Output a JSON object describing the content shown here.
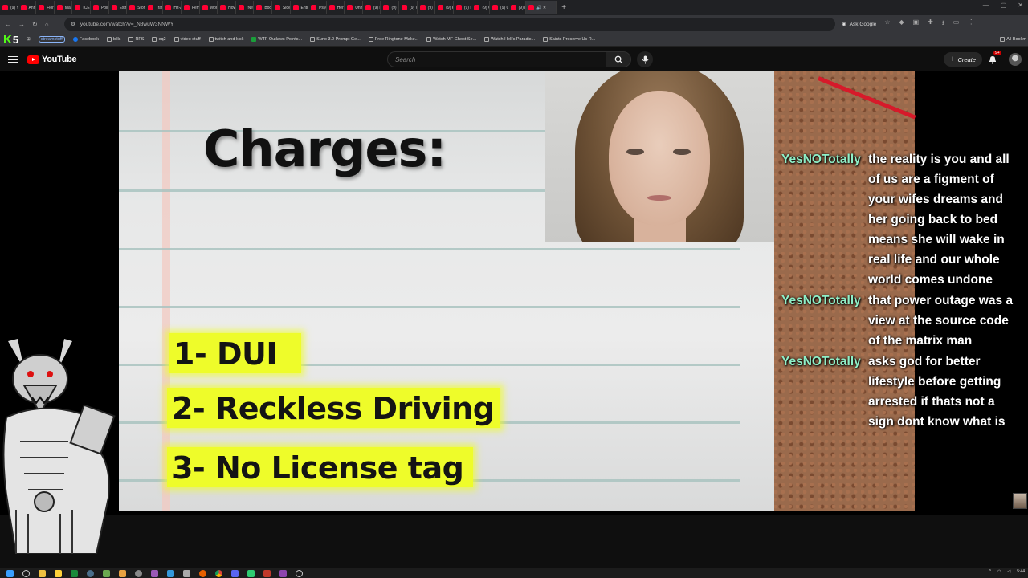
{
  "browser": {
    "tabs": [
      {
        "label": "(9) Yo"
      },
      {
        "label": "Anno"
      },
      {
        "label": "Florid"
      },
      {
        "label": "Male"
      },
      {
        "label": "ICE C"
      },
      {
        "label": "Polls"
      },
      {
        "label": "Extre"
      },
      {
        "label": "Store"
      },
      {
        "label": "Traffi"
      },
      {
        "label": "Hit-A"
      },
      {
        "label": "Fema"
      },
      {
        "label": "Wom"
      },
      {
        "label": "How"
      },
      {
        "label": "\"Nett"
      },
      {
        "label": "Body"
      },
      {
        "label": "Sidev"
      },
      {
        "label": "Entit"
      },
      {
        "label": "Psych"
      },
      {
        "label": "Her F"
      },
      {
        "label": "Unho"
      },
      {
        "label": "(9) H"
      },
      {
        "label": "(9) R"
      },
      {
        "label": "(9) W"
      },
      {
        "label": "(9) H"
      },
      {
        "label": "(9) K"
      },
      {
        "label": "(9) D"
      },
      {
        "label": "(9) Cr"
      },
      {
        "label": "(9) G"
      },
      {
        "label": "(9) E"
      }
    ],
    "url": "youtube.com/watch?v=_N8wuW3NNWY",
    "ask_google": "Ask Google",
    "bookmarks": [
      {
        "label": "streamstuff",
        "icon": "folder-icon"
      },
      {
        "label": "Facebook",
        "icon": "facebook-icon"
      },
      {
        "label": "bills",
        "icon": "folder-icon"
      },
      {
        "label": "RFS",
        "icon": "folder-icon"
      },
      {
        "label": "eq2",
        "icon": "folder-icon"
      },
      {
        "label": "video stuff",
        "icon": "folder-icon"
      },
      {
        "label": "twitch and kick",
        "icon": "folder-icon"
      },
      {
        "label": "WTF Outlaws Points...",
        "icon": "site-icon"
      },
      {
        "label": "Suno 3.0 Prompt Ge...",
        "icon": "site-icon"
      },
      {
        "label": "Free Ringtone Make...",
        "icon": "site-icon"
      },
      {
        "label": "Watch MF Ghost Se...",
        "icon": "site-icon"
      },
      {
        "label": "Watch Hell's Paradis...",
        "icon": "site-icon"
      },
      {
        "label": "Saints Preserve Us R...",
        "icon": "site-icon"
      }
    ],
    "all_bookmarks": "All Bookm"
  },
  "youtube": {
    "logo_text": "YouTube",
    "search_placeholder": "Search",
    "create_label": "Create",
    "notifications_badge": "9+"
  },
  "slide": {
    "title": "Charges:",
    "charges": [
      "1- DUI",
      "2- Reckless Driving",
      "3- No License tag"
    ]
  },
  "chat": [
    {
      "user": "YesNOTotally",
      "text": "the reality is you and all of us are a figment of your wifes dreams and her going back to bed means she will wake in real life and our whole world comes undone"
    },
    {
      "user": "YesNOTotally",
      "text": "that power outage was a view at the source code of the matrix man"
    },
    {
      "user": "YesNOTotally",
      "text": "asks god for better lifestyle before getting arrested if thats not a sign dont know what is"
    }
  ],
  "taskbar": {
    "time": "5:44"
  },
  "colors": {
    "youtube_red": "#ff0000",
    "chat_user": "#8ff0c8",
    "highlight": "#eefc2a",
    "kick_green": "#53fc18"
  }
}
